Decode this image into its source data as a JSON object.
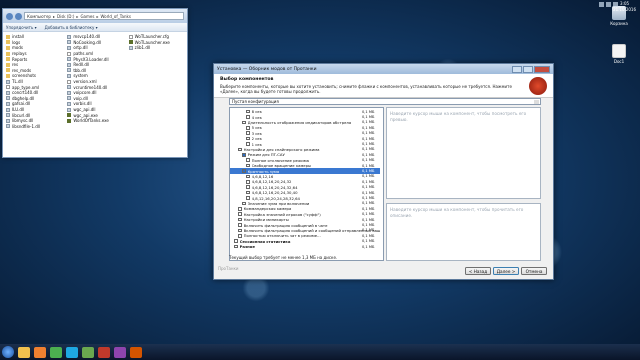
{
  "desktop": {
    "icons": [
      {
        "label": "Корзина",
        "icon": "recycle-bin-icon"
      },
      {
        "label": "Doc1",
        "icon": "text-file-icon"
      }
    ]
  },
  "explorer": {
    "breadcrumb": [
      "Компьютер",
      "Disk (D:)",
      "Games",
      "World_of_Tanks"
    ],
    "toolbar": [
      "Упорядочить ▾",
      "Добавить в библиотеку ▾"
    ],
    "files_col1": [
      {
        "name": "install",
        "type": "folder"
      },
      {
        "name": "logs",
        "type": "folder"
      },
      {
        "name": "mods",
        "type": "folder"
      },
      {
        "name": "replays",
        "type": "folder"
      },
      {
        "name": "Reports",
        "type": "folder"
      },
      {
        "name": "res",
        "type": "folder"
      },
      {
        "name": "res_mods",
        "type": "folder"
      },
      {
        "name": "screenshots",
        "type": "folder"
      },
      {
        "name": "TL.dll",
        "type": "dll"
      },
      {
        "name": "app_type.xml",
        "type": "cfg"
      },
      {
        "name": "concrt140.dll",
        "type": "dll"
      },
      {
        "name": "dbghelp.dll",
        "type": "dll"
      },
      {
        "name": "gafsai.dll",
        "type": "dll"
      },
      {
        "name": "ILU.dll",
        "type": "dll"
      },
      {
        "name": "libcurl.dll",
        "type": "dll"
      },
      {
        "name": "libmysc.dll",
        "type": "dll"
      },
      {
        "name": "libsndfile-1.dll",
        "type": "dll"
      }
    ],
    "files_col2": [
      {
        "name": "msvcp140.dll",
        "type": "dll"
      },
      {
        "name": "NoCooking.dll",
        "type": "dll"
      },
      {
        "name": "ortp.dll",
        "type": "dll"
      },
      {
        "name": "paths.xml",
        "type": "cfg"
      },
      {
        "name": "PhysX3.Loader.dll",
        "type": "dll"
      },
      {
        "name": "Redll.dll",
        "type": "dll"
      },
      {
        "name": "tbb.dll",
        "type": "dll"
      },
      {
        "name": "system",
        "type": "dll"
      },
      {
        "name": "version.xml",
        "type": "cfg"
      },
      {
        "name": "vcruntime140.dll",
        "type": "dll"
      },
      {
        "name": "voipcore.dll",
        "type": "dll"
      },
      {
        "name": "voip.dll",
        "type": "dll"
      },
      {
        "name": "vorbis.dll",
        "type": "dll"
      },
      {
        "name": "wgc_api.dll",
        "type": "dll"
      },
      {
        "name": "wgc_api.exe",
        "type": "exe"
      },
      {
        "name": "WorldOfTanks.exe",
        "type": "exe"
      }
    ],
    "files_col3": [
      {
        "name": "WoTLauncher.cfg",
        "type": "cfg"
      },
      {
        "name": "WoTLauncher.exe",
        "type": "exe"
      },
      {
        "name": "zlib1.dll",
        "type": "dll"
      }
    ]
  },
  "dialog": {
    "title": "Установка — Оборник модов от Протанки",
    "header_title": "Выбор компонентов",
    "header_text": "Выберите компоненты, которые вы хотите установить; снимите флажки с компонентов, устанавливать которые не требуется. Нажмите «Далее», когда вы будете готовы продолжить.",
    "config_select": "Пустая конфигурация",
    "tree": [
      {
        "label": "8 сек",
        "size": "0,1 МБ",
        "indent": 4,
        "checked": false
      },
      {
        "label": "4 сек",
        "size": "0,1 МБ",
        "indent": 4,
        "checked": false
      },
      {
        "label": "Длительность отображения индикаторов обстрела",
        "size": "0,1 МБ",
        "indent": 3,
        "checked": false
      },
      {
        "label": "5 сек",
        "size": "0,1 МБ",
        "indent": 4,
        "checked": false
      },
      {
        "label": "3 сек",
        "size": "0,1 МБ",
        "indent": 4,
        "checked": false
      },
      {
        "label": "2 сек",
        "size": "0,1 МБ",
        "indent": 4,
        "checked": false
      },
      {
        "label": "1 сек",
        "size": "0,1 МБ",
        "indent": 4,
        "checked": false
      },
      {
        "label": "Настройки для снайперского режима",
        "size": "0,1 МБ",
        "indent": 2,
        "checked": false
      },
      {
        "label": "Режим для ПТ-САУ",
        "size": "0,1 МБ",
        "indent": 3,
        "checked": true
      },
      {
        "label": "Полное отключение режима",
        "size": "0,1 МБ",
        "indent": 4,
        "checked": false
      },
      {
        "label": "Свободное вращение камеры",
        "size": "0,1 МБ",
        "indent": 4,
        "checked": false
      },
      {
        "label": "Кратность зума",
        "size": "0,1 МБ",
        "indent": 3,
        "checked": true,
        "selected": true
      },
      {
        "label": "4,6,8,12,16",
        "size": "0,1 МБ",
        "indent": 4,
        "checked": false
      },
      {
        "label": "4,6,8,12,16,20,24,32",
        "size": "0,1 МБ",
        "indent": 4,
        "checked": false
      },
      {
        "label": "4,6,8,12,16,20,24,32,64",
        "size": "0,1 МБ",
        "indent": 4,
        "checked": false
      },
      {
        "label": "4,6,8,12,16,20,24,30,40",
        "size": "0,1 МБ",
        "indent": 4,
        "checked": false
      },
      {
        "label": "4,8,12,16,20,24,28,32,64",
        "size": "0,1 МБ",
        "indent": 4,
        "checked": false
      },
      {
        "label": "Значение зума при включении",
        "size": "0,1 МБ",
        "indent": 3,
        "checked": false
      },
      {
        "label": "Коммандерская камера",
        "size": "0,1 МБ",
        "indent": 2,
        "checked": false
      },
      {
        "label": "Настройка значений игроков (\"суфф\")",
        "size": "0,1 МБ",
        "indent": 2,
        "checked": false
      },
      {
        "label": "Настройки миникарты",
        "size": "0,1 МБ",
        "indent": 2,
        "checked": false
      },
      {
        "label": "Включить фильтрацию сообщений в чате",
        "size": "0,1 МБ",
        "indent": 2,
        "checked": false
      },
      {
        "label": "Включить фильтрацию сообщений и сообщений отправленных ваш...",
        "size": "0,1 МБ",
        "indent": 2,
        "checked": false
      },
      {
        "label": "Полностью отключить чат в режиме...",
        "size": "0,1 МБ",
        "indent": 2,
        "checked": false
      },
      {
        "label": "Сессионная статистика",
        "size": "0,1 МБ",
        "indent": 1,
        "checked": false,
        "bold": true
      },
      {
        "label": "Разное",
        "size": "0,1 МБ",
        "indent": 1,
        "checked": false,
        "bold": true
      }
    ],
    "desc_top": "Наведите курсор мыши на компонент, чтобы посмотреть его превью.",
    "desc_bottom": "Наведите курсор мыши на компонент, чтобы прочитать его описание.",
    "requirement": "Текущий выбор требует не менее 1,3 МБ на диске.",
    "brand": "ПроТанки",
    "buttons": {
      "back": "< Назад",
      "next": "Далее >",
      "cancel": "Отмена"
    }
  },
  "taskbar": {
    "items": [
      "start-orb-icon",
      "explorer-icon",
      "media-player-icon",
      "chrome-icon",
      "skype-icon",
      "utorrent-icon",
      "game-icon",
      "installer-icon",
      "recorder-icon"
    ],
    "item_colors": [
      "#e0e0e0",
      "#f2c14e",
      "#f08030",
      "#4caf50",
      "#1ea7e1",
      "#6aa84f",
      "#c0392b",
      "#8e44ad",
      "#d35400"
    ],
    "time": "3:05",
    "date": "21.10.2016"
  }
}
